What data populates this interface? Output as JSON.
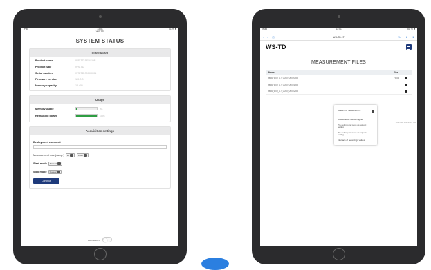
{
  "left": {
    "statusbar": {
      "left": "iPad",
      "time": "13:51",
      "sub": "WS-TD",
      "battery": "51 % ■"
    },
    "title": "SYSTEM STATUS",
    "information": {
      "header": "Information",
      "rows": [
        {
          "label": "Product name",
          "value": "WS-TD SENSOR"
        },
        {
          "label": "Product type",
          "value": "WS-TD"
        },
        {
          "label": "Serial number",
          "value": "WS-TD 00000001"
        },
        {
          "label": "Firmware version",
          "value": "1.0.0.0"
        },
        {
          "label": "Memory capacity",
          "value": "16 GB"
        }
      ]
    },
    "usage": {
      "header": "Usage",
      "rows": [
        {
          "label": "Memory usage",
          "percent": 8,
          "text": "8%"
        },
        {
          "label": "Remaining power",
          "percent": 100,
          "text": "100%"
        }
      ]
    },
    "acquisition": {
      "header": "Acquisition settings",
      "deployment_label": "Deployment comment",
      "deployment_value": "",
      "rate_label": "Measurement rate (samp.)",
      "rate_values": [
        "10",
        "2048"
      ],
      "start_label": "Start mode",
      "start_value": "Manual",
      "stop_label": "Stop mode",
      "stop_value": "Manual",
      "button": "Continue"
    },
    "advanced_label": "Advanced"
  },
  "right": {
    "statusbar": {
      "left": "iPad",
      "time": "13:51",
      "battery": "51 % ■"
    },
    "url": "WS-TD.LT",
    "brand": "WS-TD",
    "title": "MEASUREMENT FILES",
    "columns": {
      "name": "Name",
      "size": "Size"
    },
    "files": [
      {
        "name": "ts36_w09_07_0000_00000.tid",
        "size": "75 kB"
      },
      {
        "name": "ts36_w09_07_0000_00001.tid",
        "size": ""
      },
      {
        "name": "ts36_w09_07_0000_00002.tid",
        "size": ""
      }
    ],
    "free_space": "Free disk space: 16 GB",
    "popup": [
      "Delete this measurement",
      "Download as measuring file",
      "Pre-setting and save as export 1 setting",
      "Pre-setting and save as export 2 setting",
      "Interface of recordings values"
    ]
  }
}
